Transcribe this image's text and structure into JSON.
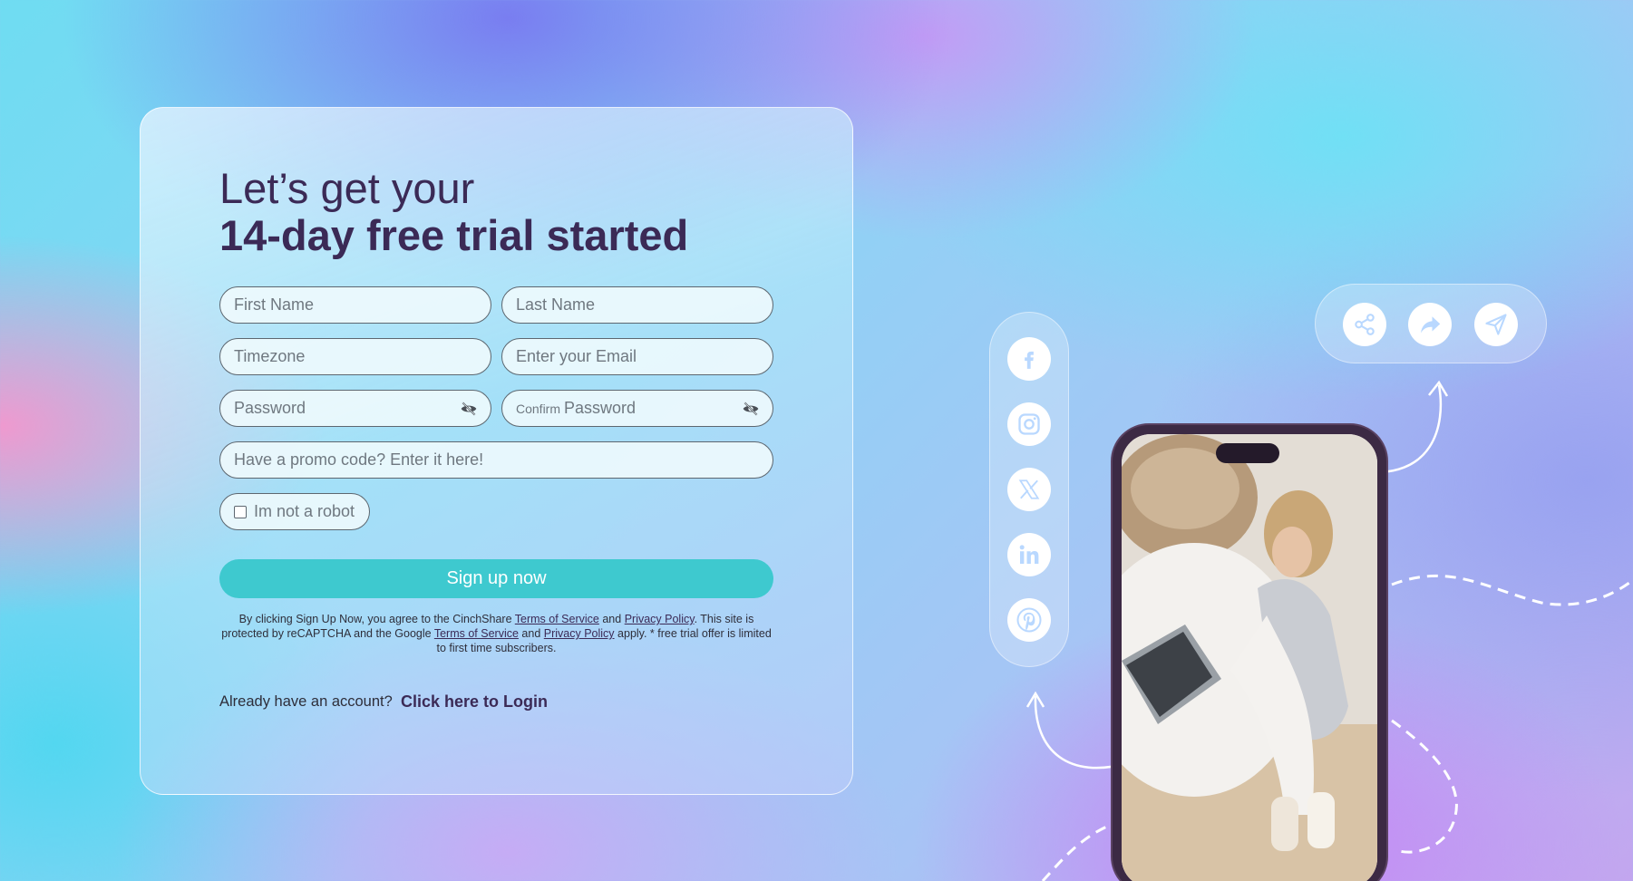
{
  "form": {
    "title_line1": "Let’s get your",
    "title_line2": "14-day free trial started",
    "first_name_placeholder": "First Name",
    "last_name_placeholder": "Last Name",
    "timezone_placeholder": "Timezone",
    "email_placeholder": "Enter your Email",
    "password_placeholder": "Password",
    "confirm_prefix": "Confirm",
    "confirm_password_placeholder": "Password",
    "promo_placeholder": "Have a promo code? Enter it here!",
    "robot_label": "Im not a robot",
    "signup_label": "Sign up now",
    "legal": {
      "part1": "By clicking Sign Up Now, you agree to the CinchShare ",
      "terms1": "Terms of Service",
      "and1": " and ",
      "privacy1": "Privacy Policy",
      "part2": ". This site is protected by reCAPTCHA and the Google ",
      "terms2": "Terms of Service",
      "and2": " and ",
      "privacy2": "Privacy Policy",
      "part3": " apply. * free trial offer is limited to first time subscribers."
    },
    "already_label": "Already have an account?",
    "login_label": "Click here to Login"
  },
  "social_icons": [
    "facebook-icon",
    "instagram-icon",
    "x-twitter-icon",
    "linkedin-icon",
    "pinterest-icon"
  ],
  "share_icons": [
    "share-icon",
    "forward-icon",
    "send-icon"
  ],
  "colors": {
    "title": "#3b2a56",
    "button": "#3ec9cf",
    "icon_blue": "#b9d8ff",
    "field_border": "#5d6770"
  }
}
